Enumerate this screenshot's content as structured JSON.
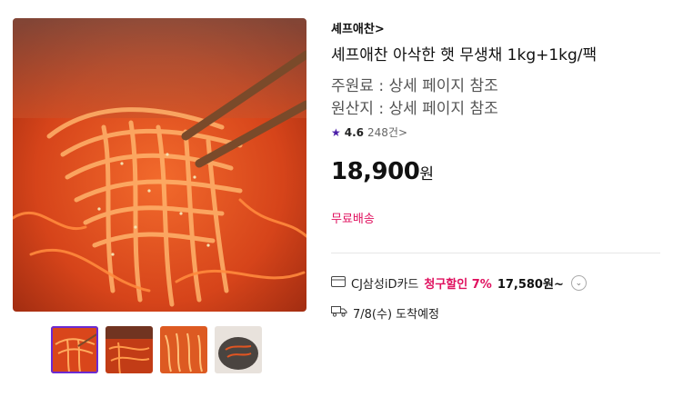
{
  "product": {
    "brand": "셰프애찬",
    "brand_chevron": ">",
    "title": "셰프애찬 아삭한 햇 무생채 1kg+1kg/팩",
    "ingredients": "주원료 : 상세 페이지 참조",
    "origin": "원산지 : 상세 페이지 참조",
    "rating": "4.6",
    "review_count": "248건",
    "review_chevron": ">",
    "price": "18,900",
    "currency": "원",
    "shipping": "무료배송"
  },
  "card_offer": {
    "card_name": "CJ삼성iD카드",
    "discount_label": "청구할인 7%",
    "discounted_price": "17,580원~"
  },
  "delivery": {
    "text": "7/8(수) 도착예정"
  },
  "thumbnails": [
    {
      "icon": "food-photo-1",
      "selected": true
    },
    {
      "icon": "food-photo-2",
      "selected": false
    },
    {
      "icon": "food-photo-3",
      "selected": false
    },
    {
      "icon": "food-photo-4",
      "selected": false
    }
  ],
  "colors": {
    "accent": "#e0115f",
    "brand_purple": "#4b1fa8"
  }
}
